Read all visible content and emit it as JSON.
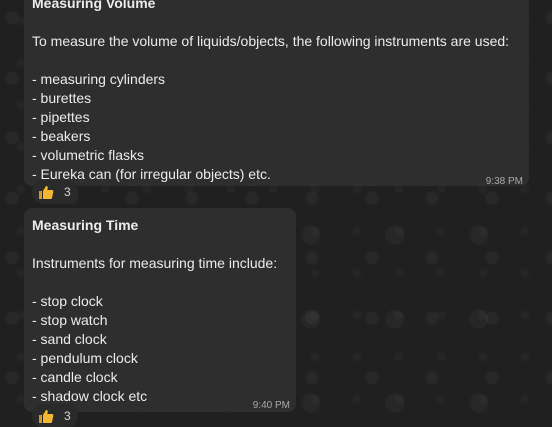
{
  "messages": [
    {
      "title": "Measuring Volume",
      "intro": "To measure the volume of liquids/objects, the following instruments are used:",
      "items": [
        "- measuring cylinders",
        "- burettes",
        "- pipettes",
        "- beakers",
        "- volumetric flasks",
        "- Eureka can (for irregular objects) etc."
      ],
      "time": "9:38 PM",
      "reaction": {
        "icon": "thumbs-up-icon",
        "count": "3"
      }
    },
    {
      "title": "Measuring Time",
      "intro": "Instruments for measuring time include:",
      "items": [
        "- stop clock",
        "- stop watch",
        "- sand clock",
        "- pendulum clock",
        "- candle clock",
        "- shadow clock etc"
      ],
      "time": "9:40 PM",
      "reaction": {
        "icon": "thumbs-up-icon",
        "count": "3"
      }
    }
  ],
  "colors": {
    "bubble": "#2e2e2e",
    "background": "#202020",
    "reaction_icon": "#f5b631"
  }
}
